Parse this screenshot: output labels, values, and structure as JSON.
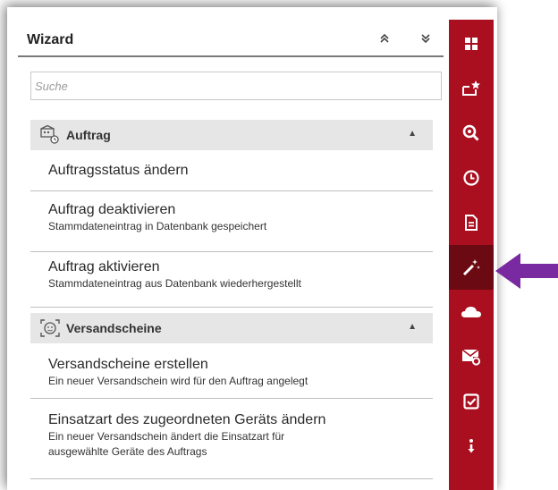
{
  "wizard": {
    "title": "Wizard",
    "collapse_all_icon": "double-chevron-up-icon",
    "expand_all_icon": "double-chevron-down-icon"
  },
  "search": {
    "placeholder": "Suche",
    "value": ""
  },
  "sections": [
    {
      "label": "Auftrag",
      "icon": "order-settings-icon",
      "items": [
        {
          "title": "Auftragsstatus ändern",
          "subtitle": ""
        },
        {
          "title": "Auftrag deaktivieren",
          "subtitle": "Stammdateneintrag in Datenbank gespeichert"
        },
        {
          "title": "Auftrag aktivieren",
          "subtitle": "Stammdateneintrag aus Datenbank wiederhergestellt"
        }
      ]
    },
    {
      "label": "Versandscheine",
      "icon": "scan-face-icon",
      "items": [
        {
          "title": "Versandscheine erstellen",
          "subtitle": "Ein neuer Versandschein wird für den Auftrag angelegt"
        },
        {
          "title": "Einsatzart des zugeordneten Geräts ändern",
          "subtitle": "Ein neuer Versandschein ändert die Einsatzart für",
          "subtitle2": "ausgewählte Geräte des Auftrags"
        }
      ]
    }
  ],
  "sidebar": {
    "items": [
      {
        "icon": "dashboard-grid-icon"
      },
      {
        "icon": "favorite-folder-icon"
      },
      {
        "icon": "search-icon"
      },
      {
        "icon": "history-clock-icon"
      },
      {
        "icon": "document-icon"
      },
      {
        "icon": "magic-wand-icon",
        "active": true
      },
      {
        "icon": "cloud-icon"
      },
      {
        "icon": "mail-icon"
      },
      {
        "icon": "checkbox-icon"
      },
      {
        "icon": "more-info-icon"
      }
    ]
  },
  "colors": {
    "sidebar": "#a90f1e",
    "sidebar_active": "#6b0a13",
    "arrow": "#7a2aa0",
    "section_bg": "#e6e6e6"
  }
}
